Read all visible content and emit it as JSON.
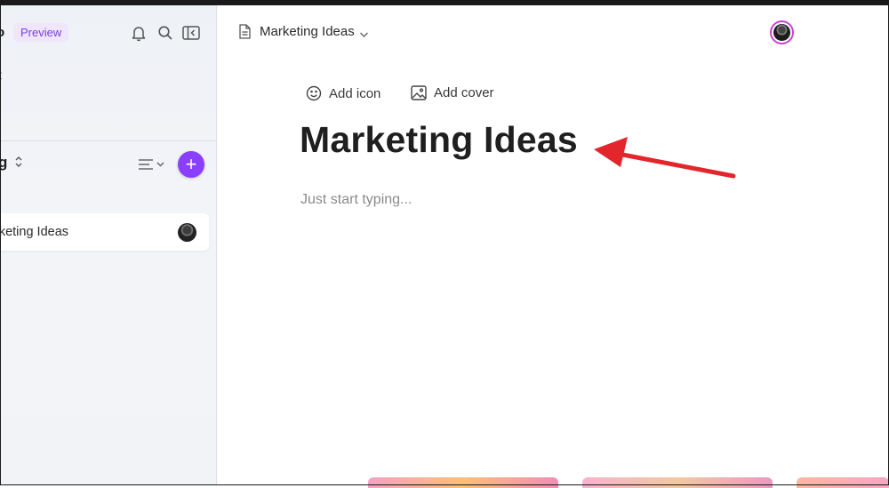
{
  "sidebar": {
    "brand_fragment": "o",
    "preview_badge": "Preview",
    "nav_fragment": "t",
    "workspace_fragment": "g",
    "page_item_label": "rketing Ideas"
  },
  "topbar": {
    "doc_title": "Marketing Ideas"
  },
  "document": {
    "add_icon_label": "Add icon",
    "add_cover_label": "Add cover",
    "title": "Marketing Ideas",
    "body_placeholder": "Just start typing..."
  },
  "icons": {
    "bell": "bell-icon",
    "search": "search-icon",
    "collapse": "sidebar-collapse-icon",
    "sort": "sort-lines-icon",
    "add": "plus-icon",
    "doc": "document-icon",
    "smile": "smile-icon",
    "image": "image-icon"
  },
  "colors": {
    "accent": "#8a3ffc",
    "badge_bg": "#efe6fb",
    "badge_text": "#7a3fd6",
    "annotation_arrow": "#e3262b"
  }
}
